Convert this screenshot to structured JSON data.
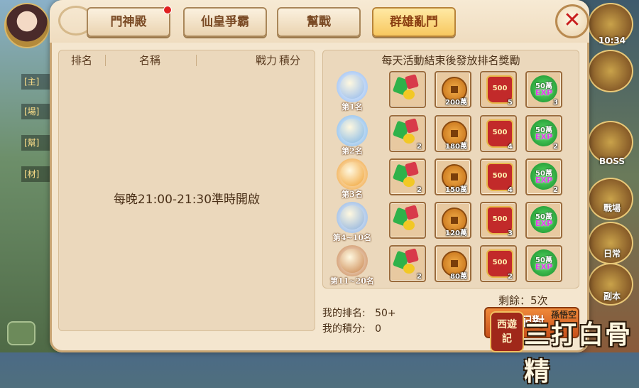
{
  "tabs": [
    {
      "label": "門神殿",
      "active": false,
      "has_red_dot": true
    },
    {
      "label": "仙皇爭霸",
      "active": false,
      "has_red_dot": false
    },
    {
      "label": "幫戰",
      "active": false,
      "has_red_dot": false
    },
    {
      "label": "群雄亂鬥",
      "active": true,
      "has_red_dot": false
    }
  ],
  "close_icon": "✕",
  "ranking_table": {
    "headers": [
      "排名",
      "名稱",
      "戰力",
      "積分"
    ],
    "empty_message": "每晚21:00-21:30準時開啟"
  },
  "rewards": {
    "title": "每天活動結束後發放排名獎勵",
    "tiers": [
      {
        "rank_label": "第1名",
        "medal": "crown-medal",
        "medal_color": "#8fb8f0",
        "items": [
          {
            "type": "gems",
            "count": ""
          },
          {
            "type": "coin",
            "count": "200萬"
          },
          {
            "type": "red-bag",
            "label": "500",
            "count": "5"
          },
          {
            "type": "exp",
            "label_top": "50萬",
            "label_bottom": "EXP",
            "count": "3"
          }
        ]
      },
      {
        "rank_label": "第2名",
        "medal": "trophy-medal",
        "medal_color": "#7fb6e8",
        "items": [
          {
            "type": "gems",
            "count": "2"
          },
          {
            "type": "coin",
            "count": "180萬"
          },
          {
            "type": "red-bag",
            "label": "500",
            "count": "4"
          },
          {
            "type": "exp",
            "label_top": "50萬",
            "label_bottom": "EXP",
            "count": "2"
          }
        ]
      },
      {
        "rank_label": "第3名",
        "medal": "gold-orb-medal",
        "medal_color": "#f0a030",
        "items": [
          {
            "type": "gems",
            "count": "2"
          },
          {
            "type": "coin",
            "count": "150萬"
          },
          {
            "type": "red-bag",
            "label": "500",
            "count": "4"
          },
          {
            "type": "exp",
            "label_top": "50萬",
            "label_bottom": "EXP",
            "count": "2"
          }
        ]
      },
      {
        "rank_label": "第4~10名",
        "medal": "silver-orb-medal",
        "medal_color": "#8ab0e0",
        "items": [
          {
            "type": "gems",
            "count": ""
          },
          {
            "type": "coin",
            "count": "120萬"
          },
          {
            "type": "red-bag",
            "label": "500",
            "count": "3"
          },
          {
            "type": "exp",
            "label_top": "50萬",
            "label_bottom": "EXP",
            "count": ""
          }
        ]
      },
      {
        "rank_label": "第11~20名",
        "medal": "bronze-orb-medal",
        "medal_color": "#c8824a",
        "items": [
          {
            "type": "gems",
            "count": "2"
          },
          {
            "type": "coin",
            "count": "80萬"
          },
          {
            "type": "red-bag",
            "label": "500",
            "count": "2"
          },
          {
            "type": "exp",
            "label_top": "50萬",
            "label_bottom": "EXP",
            "count": ""
          }
        ]
      }
    ]
  },
  "remaining": "剩餘：5次",
  "my_rank": {
    "label": "我的排名:",
    "value": "50+"
  },
  "my_score": {
    "label": "我的積分:",
    "value": "0"
  },
  "match_button": "配對",
  "background": {
    "chat_tags": [
      "[主]",
      "[場]",
      "[幫]",
      "[材]"
    ],
    "right_labels": [
      "BOSS",
      "戰場",
      "日常",
      "副本"
    ],
    "time": "10:34"
  },
  "watermark": {
    "seal": "西遊記",
    "text": "三打白骨精",
    "sub": "孫悟空"
  }
}
